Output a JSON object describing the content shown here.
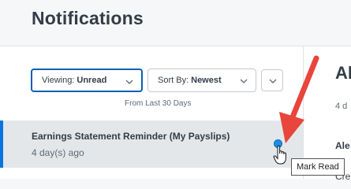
{
  "header": {
    "title": "Notifications"
  },
  "filters": {
    "viewing_label": "Viewing:",
    "viewing_value": "Unread",
    "sort_label": "Sort By:",
    "sort_value": "Newest",
    "range_text": "From Last 30 Days"
  },
  "notifications": [
    {
      "title": "Earnings Statement Reminder (My Payslips)",
      "time": "4 day(s) ago",
      "unread": true
    }
  ],
  "detail": {
    "title_fragment": "Al",
    "meta_fragment": "4 d",
    "line2_fragment": "Ale",
    "line3_fragment": "Cre"
  },
  "tooltip": {
    "text": "Mark Read"
  },
  "colors": {
    "accent": "#0875e1",
    "selected_row": "#e4e7ea",
    "annotation_arrow": "#e8453c"
  },
  "icons": [
    "chevron-down-icon",
    "unread-dot-icon",
    "hand-pointer-icon",
    "arrow-annotation-icon"
  ]
}
